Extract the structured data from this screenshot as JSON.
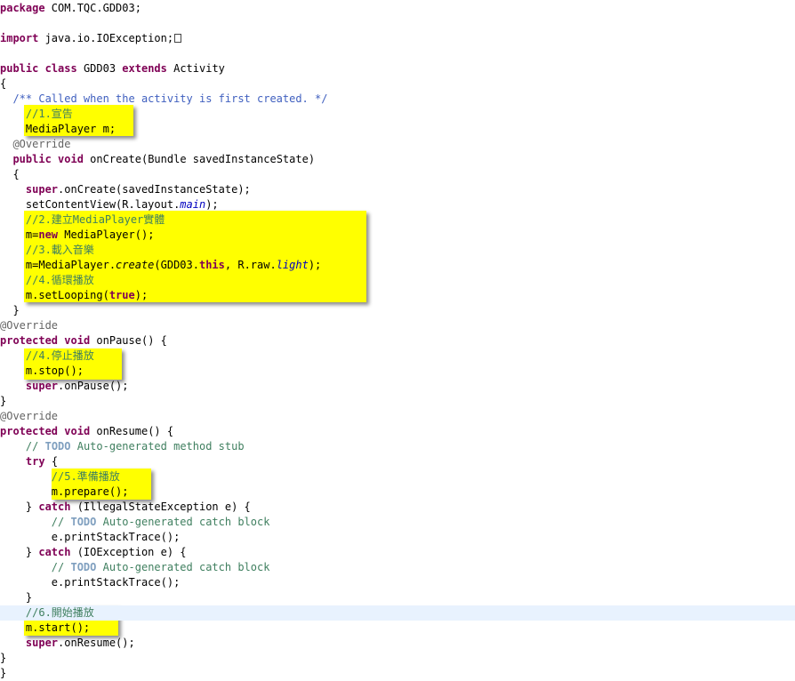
{
  "colors": {
    "keyword": "#7f0055",
    "annotation": "#646464",
    "comment": "#3f7f5f",
    "javadoc": "#3f5fbf",
    "todo": "#7f9fbf",
    "field": "#0000c0",
    "highlight": "#ffff00",
    "current_line": "#e8f2fe"
  },
  "icons": {
    "fold": "folded-import-marker"
  },
  "editor": {
    "current_line": 40,
    "lines": [
      [
        [
          "kw",
          "package"
        ],
        [
          "plain",
          " COM.TQC.GDD03;"
        ]
      ],
      [],
      [
        [
          "kw",
          "import"
        ],
        [
          "plain",
          " java.io.IOException;"
        ]
      ],
      [],
      [
        [
          "kw",
          "public"
        ],
        [
          "plain",
          " "
        ],
        [
          "kw",
          "class"
        ],
        [
          "plain",
          " GDD03 "
        ],
        [
          "kw",
          "extends"
        ],
        [
          "plain",
          " Activity"
        ]
      ],
      [
        [
          "plain",
          "{"
        ]
      ],
      [
        [
          "plain",
          "  "
        ],
        [
          "doc",
          "/** Called when the activity is first created. */"
        ]
      ],
      [
        [
          "plain",
          "    "
        ],
        [
          "cmt",
          "//1.宣告"
        ]
      ],
      [
        [
          "plain",
          "    MediaPlayer m;"
        ]
      ],
      [
        [
          "plain",
          "  "
        ],
        [
          "ann",
          "@Override"
        ]
      ],
      [
        [
          "plain",
          "  "
        ],
        [
          "kw",
          "public"
        ],
        [
          "plain",
          " "
        ],
        [
          "kw",
          "void"
        ],
        [
          "plain",
          " onCreate(Bundle savedInstanceState)"
        ]
      ],
      [
        [
          "plain",
          "  {"
        ]
      ],
      [
        [
          "plain",
          "    "
        ],
        [
          "kw",
          "super"
        ],
        [
          "plain",
          ".onCreate(savedInstanceState);"
        ]
      ],
      [
        [
          "plain",
          "    setContentView(R.layout."
        ],
        [
          "fld",
          "main"
        ],
        [
          "plain",
          ");"
        ]
      ],
      [
        [
          "plain",
          "    "
        ],
        [
          "cmt",
          "//2.建立MediaPlayer實體"
        ]
      ],
      [
        [
          "plain",
          "    m="
        ],
        [
          "kw",
          "new"
        ],
        [
          "plain",
          " MediaPlayer();"
        ]
      ],
      [
        [
          "plain",
          "    "
        ],
        [
          "cmt",
          "//3.載入音樂"
        ]
      ],
      [
        [
          "plain",
          "    m=MediaPlayer."
        ],
        [
          "ital",
          "create"
        ],
        [
          "plain",
          "(GDD03."
        ],
        [
          "kw",
          "this"
        ],
        [
          "plain",
          ", R.raw."
        ],
        [
          "fld",
          "light"
        ],
        [
          "plain",
          ");"
        ]
      ],
      [
        [
          "plain",
          "    "
        ],
        [
          "cmt",
          "//4.循環播放"
        ]
      ],
      [
        [
          "plain",
          "    m.setLooping("
        ],
        [
          "kw",
          "true"
        ],
        [
          "plain",
          ");"
        ]
      ],
      [
        [
          "plain",
          "  }"
        ]
      ],
      [
        [
          "ann",
          "@Override"
        ]
      ],
      [
        [
          "kw",
          "protected"
        ],
        [
          "plain",
          " "
        ],
        [
          "kw",
          "void"
        ],
        [
          "plain",
          " onPause() {"
        ]
      ],
      [
        [
          "plain",
          "    "
        ],
        [
          "cmt",
          "//4.停止播放"
        ]
      ],
      [
        [
          "plain",
          "    m.stop();"
        ]
      ],
      [
        [
          "plain",
          "    "
        ],
        [
          "kw",
          "super"
        ],
        [
          "plain",
          ".onPause();"
        ]
      ],
      [
        [
          "plain",
          "}"
        ]
      ],
      [
        [
          "ann",
          "@Override"
        ]
      ],
      [
        [
          "kw",
          "protected"
        ],
        [
          "plain",
          " "
        ],
        [
          "kw",
          "void"
        ],
        [
          "plain",
          " onResume() {"
        ]
      ],
      [
        [
          "plain",
          "    "
        ],
        [
          "cmt",
          "// "
        ],
        [
          "todo",
          "TODO"
        ],
        [
          "cmt",
          " Auto-generated method stub"
        ]
      ],
      [
        [
          "plain",
          "    "
        ],
        [
          "kw",
          "try"
        ],
        [
          "plain",
          " {"
        ]
      ],
      [
        [
          "plain",
          "        "
        ],
        [
          "cmt",
          "//5.準備播放"
        ]
      ],
      [
        [
          "plain",
          "        m.prepare();"
        ]
      ],
      [
        [
          "plain",
          "    } "
        ],
        [
          "kw",
          "catch"
        ],
        [
          "plain",
          " (IllegalStateException e) {"
        ]
      ],
      [
        [
          "plain",
          "        "
        ],
        [
          "cmt",
          "// "
        ],
        [
          "todo",
          "TODO"
        ],
        [
          "cmt",
          " Auto-generated catch block"
        ]
      ],
      [
        [
          "plain",
          "        e.printStackTrace();"
        ]
      ],
      [
        [
          "plain",
          "    } "
        ],
        [
          "kw",
          "catch"
        ],
        [
          "plain",
          " (IOException e) {"
        ]
      ],
      [
        [
          "plain",
          "        "
        ],
        [
          "cmt",
          "// "
        ],
        [
          "todo",
          "TODO"
        ],
        [
          "cmt",
          " Auto-generated catch block"
        ]
      ],
      [
        [
          "plain",
          "        e.printStackTrace();"
        ]
      ],
      [
        [
          "plain",
          "    }"
        ]
      ],
      [
        [
          "plain",
          "    "
        ],
        [
          "cmt",
          "//6.開始播放"
        ]
      ],
      [
        [
          "plain",
          "    m.start();"
        ]
      ],
      [
        [
          "plain",
          "    "
        ],
        [
          "kw",
          "super"
        ],
        [
          "plain",
          ".onResume();"
        ]
      ],
      [
        [
          "plain",
          "}"
        ]
      ],
      [
        [
          "plain",
          "}"
        ]
      ]
    ]
  }
}
